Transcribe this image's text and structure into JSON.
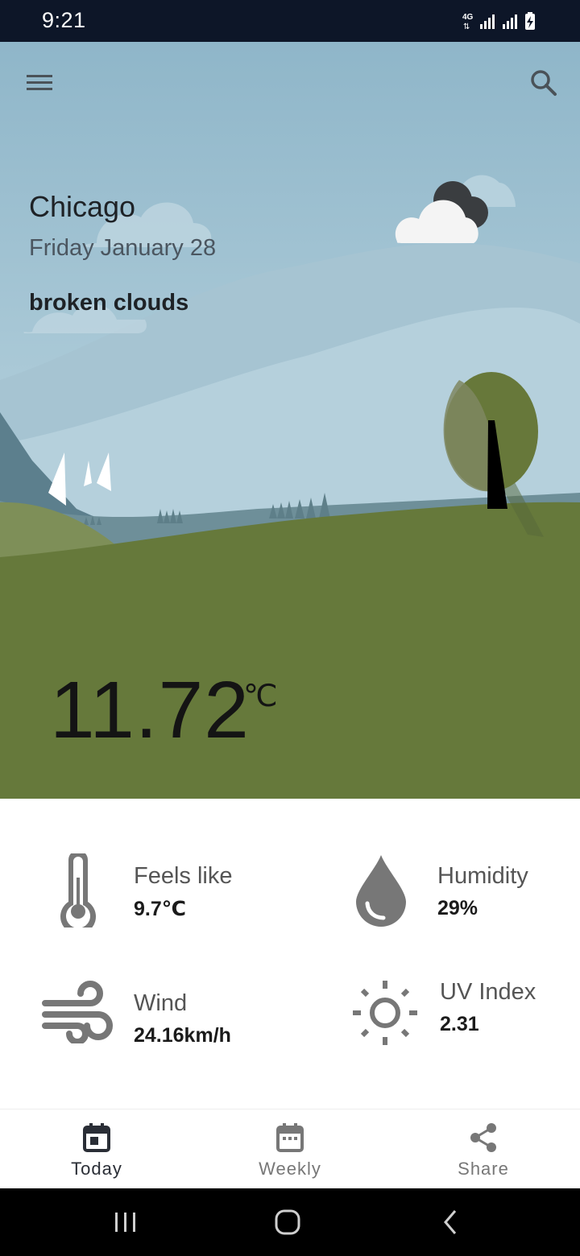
{
  "status_bar": {
    "time": "9:21",
    "network": "4G"
  },
  "header": {
    "menu_icon": "hamburger-menu-icon",
    "search_icon": "search-icon"
  },
  "weather": {
    "city": "Chicago",
    "date": "Friday January 28",
    "description": "broken clouds",
    "temperature": "11.72",
    "unit": "℃",
    "condition_icon": "broken-clouds-icon"
  },
  "metrics": {
    "feels_like": {
      "label": "Feels like",
      "value": "9.7℃",
      "icon": "thermometer-icon"
    },
    "humidity": {
      "label": "Humidity",
      "value": "29%",
      "icon": "water-drop-icon"
    },
    "wind": {
      "label": "Wind",
      "value": "24.16km/h",
      "icon": "wind-icon"
    },
    "uv_index": {
      "label": "UV Index",
      "value": "2.31",
      "icon": "sun-icon"
    }
  },
  "bottom_nav": {
    "items": [
      {
        "label": "Today",
        "icon": "calendar-today-icon",
        "active": true
      },
      {
        "label": "Weekly",
        "icon": "calendar-week-icon",
        "active": false
      },
      {
        "label": "Share",
        "icon": "share-icon",
        "active": false
      }
    ]
  },
  "colors": {
    "status_bar": "#0d1628",
    "sky": "#a7c6d6",
    "grass": "#66793b",
    "icon_gray": "#777777",
    "nav_active": "#2a2e36",
    "nav_inactive": "#777777"
  }
}
